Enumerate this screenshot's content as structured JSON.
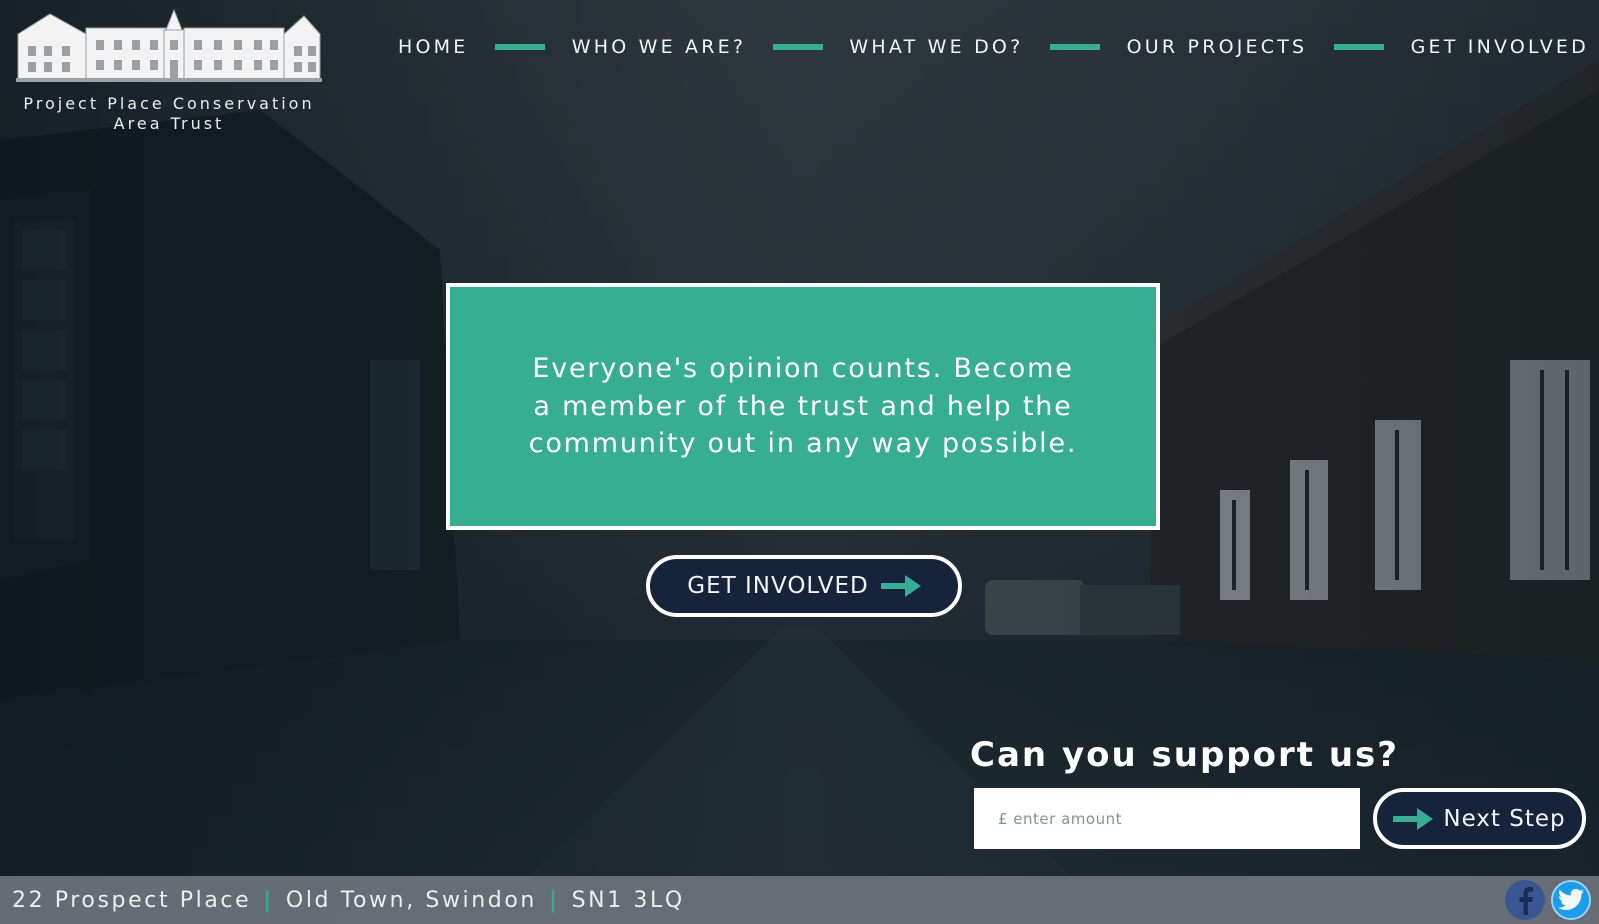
{
  "brand": {
    "name": "Project Place Conservation Area Trust"
  },
  "nav": {
    "items": [
      {
        "label": "HOME"
      },
      {
        "label": "WHO WE ARE?"
      },
      {
        "label": "WHAT WE DO?"
      },
      {
        "label": "OUR PROJECTS"
      },
      {
        "label": "GET INVOLVED"
      }
    ],
    "separator_color": "#37ad91"
  },
  "hero": {
    "message": "Everyone's opinion counts. Become a member of the trust and help the community out in any way possible.",
    "button_label": "GET INVOLVED",
    "button_icon": "arrow-right-icon",
    "box_color": "#37ad91"
  },
  "support": {
    "title": "Can you support us?",
    "amount_placeholder": "£ enter amount",
    "amount_value": "",
    "next_label": "Next Step",
    "next_icon": "arrow-right-icon"
  },
  "footer": {
    "address_line1": "22 Prospect Place",
    "address_line2": "Old Town, Swindon",
    "postcode": "SN1 3LQ",
    "separator": "|",
    "socials": [
      {
        "name": "facebook-icon",
        "color": "#3b5998"
      },
      {
        "name": "twitter-icon",
        "color": "#1da1f2"
      }
    ]
  },
  "colors": {
    "accent": "#37ad91",
    "dark_button": "#16233a",
    "footer_bg": "#6a7078"
  }
}
